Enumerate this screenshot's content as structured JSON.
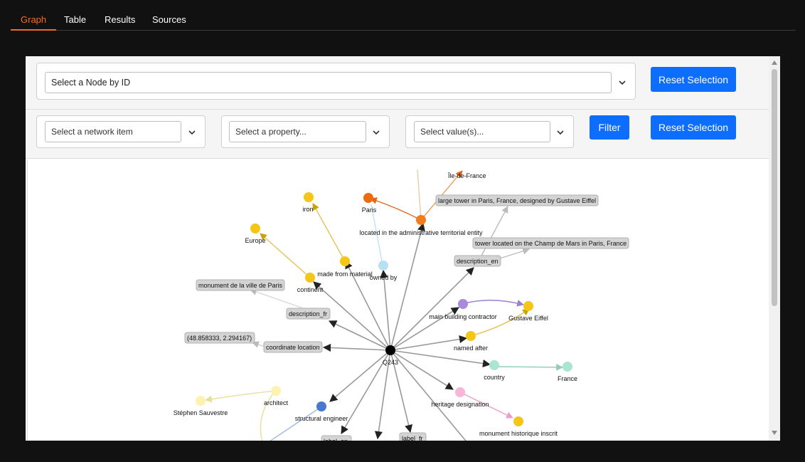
{
  "tabs": [
    {
      "label": "Graph",
      "active": true
    },
    {
      "label": "Table",
      "active": false
    },
    {
      "label": "Results",
      "active": false
    },
    {
      "label": "Sources",
      "active": false
    }
  ],
  "node_select": {
    "placeholder": "Select a Node by ID",
    "reset_label": "Reset Selection"
  },
  "filter": {
    "network_item_placeholder": "Select a network item",
    "property_placeholder": "Select a property...",
    "value_placeholder": "Select value(s)...",
    "filter_label": "Filter",
    "reset_label": "Reset Selection"
  },
  "graph": {
    "center": {
      "label": "Q243",
      "color": "#000000"
    },
    "nodes": [
      {
        "label": "Île-de-France",
        "color": "#f7f7f7"
      },
      {
        "label": "iron",
        "color": "#f5c518"
      },
      {
        "label": "Paris",
        "color": "#ee6a10"
      },
      {
        "label": "located in the administrative territorial entity",
        "color": "#f47c1c"
      },
      {
        "label": "Europe",
        "color": "#f5c518"
      },
      {
        "label": "made from material",
        "color": "#f5c518"
      },
      {
        "label": "owned by",
        "color": "#b8e0f5"
      },
      {
        "label": "continent",
        "color": "#f5c518"
      },
      {
        "label": "main building contractor",
        "color": "#a98bdc"
      },
      {
        "label": "Gustave Eiffel",
        "color": "#f5c518"
      },
      {
        "label": "named after",
        "color": "#f5c518"
      },
      {
        "label": "country",
        "color": "#a8e6cf"
      },
      {
        "label": "France",
        "color": "#a8e6cf"
      },
      {
        "label": "architect",
        "color": "#fdf2b0"
      },
      {
        "label": "Stéphen Sauvestre",
        "color": "#fdf2b0"
      },
      {
        "label": "structural engineer",
        "color": "#4a78d0"
      },
      {
        "label": "heritage designation",
        "color": "#f7b6d8"
      },
      {
        "label": "monument historique inscrit",
        "color": "#f5c518"
      }
    ],
    "boxes": [
      {
        "label": "large tower in Paris, France, designed by Gustave Eiffel"
      },
      {
        "label": "tower located on the Champ de Mars in Paris, France"
      },
      {
        "label": "description_en"
      },
      {
        "label": "monument de la ville de Paris"
      },
      {
        "label": "description_fr"
      },
      {
        "label": "(48.858333, 2.294167)"
      },
      {
        "label": "coordinate location"
      },
      {
        "label": "label_en"
      },
      {
        "label": "label_fr"
      }
    ]
  }
}
